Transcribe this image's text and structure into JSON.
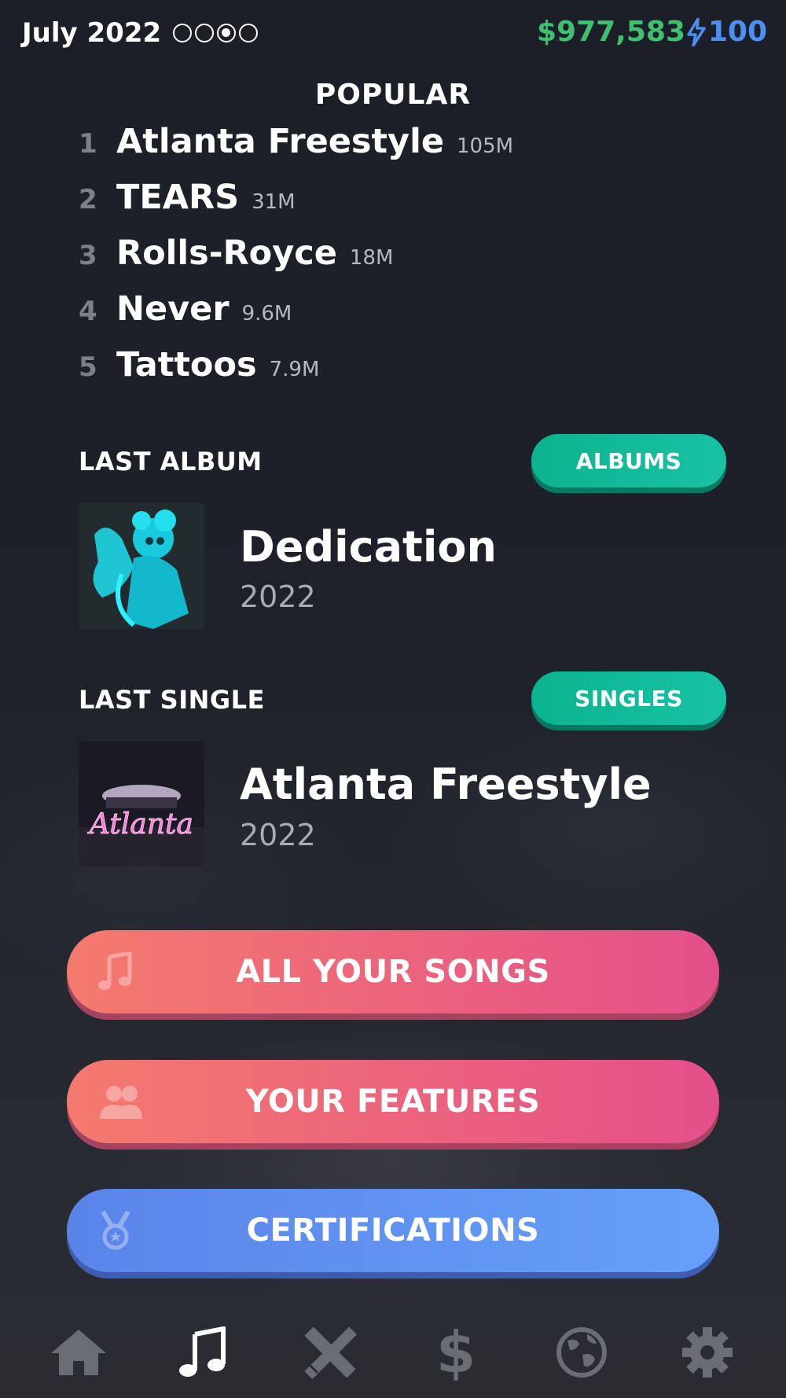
{
  "header": {
    "date": "July 2022",
    "week_indicator": {
      "total": 4,
      "current": 3
    },
    "money": "$977,583",
    "energy": "100",
    "colors": {
      "money": "#3fbf6f",
      "energy": "#4d8ff0"
    }
  },
  "popular": {
    "title": "POPULAR",
    "songs": [
      {
        "rank": "1",
        "name": "Atlanta Freestyle",
        "streams": "105M"
      },
      {
        "rank": "2",
        "name": "TEARS",
        "streams": "31M"
      },
      {
        "rank": "3",
        "name": "Rolls-Royce",
        "streams": "18M"
      },
      {
        "rank": "4",
        "name": "Never",
        "streams": "9.6M"
      },
      {
        "rank": "5",
        "name": "Tattoos",
        "streams": "7.9M"
      }
    ]
  },
  "last_album": {
    "label": "LAST ALBUM",
    "button": "ALBUMS",
    "title": "Dedication",
    "year": "2022"
  },
  "last_single": {
    "label": "LAST SINGLE",
    "button": "SINGLES",
    "title": "Atlanta Freestyle",
    "year": "2022",
    "cover_text": "Atlanta"
  },
  "actions": {
    "all_songs": "ALL YOUR SONGS",
    "features": "YOUR FEATURES",
    "certifications": "CERTIFICATIONS"
  },
  "nav": {
    "items": [
      "home-icon",
      "music-note-icon",
      "pencil-ruler-icon",
      "dollar-icon",
      "globe-icon",
      "gear-icon"
    ],
    "active": "music-note-icon"
  }
}
